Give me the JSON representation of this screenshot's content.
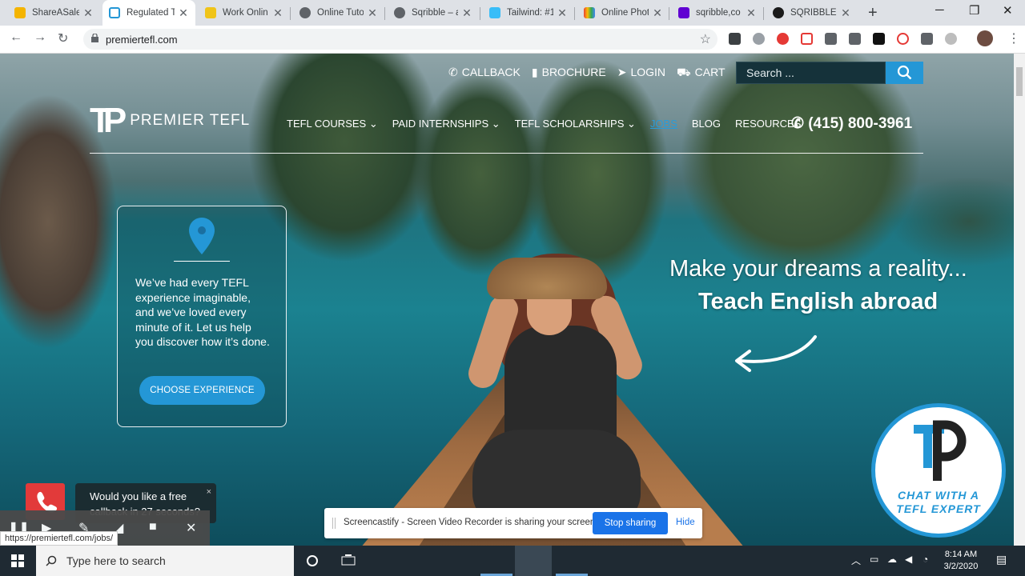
{
  "tabs": [
    {
      "title": "ShareASale",
      "color": "#f4b400"
    },
    {
      "title": "Regulated T",
      "color": "#2497d6"
    },
    {
      "title": "Work Onlin",
      "color": "#f0c419"
    },
    {
      "title": "Online Tuto",
      "color": "#5f6368"
    },
    {
      "title": "Sqribble – a",
      "color": "#5f6368"
    },
    {
      "title": "Tailwind: #1",
      "color": "#38bdf8"
    },
    {
      "title": "Online Phot",
      "color": "#e94235"
    },
    {
      "title": "sqribble,co",
      "color": "#6001d2"
    },
    {
      "title": "SQRIBBLE -",
      "color": "#1a1a1a"
    }
  ],
  "browser": {
    "url": "premiertefl.com",
    "status_url": "https://premiertefl.com/jobs/"
  },
  "site": {
    "toplinks": [
      "CALLBACK",
      "BROCHURE",
      "LOGIN",
      "CART"
    ],
    "search_placeholder": "Search ...",
    "logo_mark": "TP",
    "logo_name": "PREMIER TEFL",
    "nav": [
      "TEFL COURSES",
      "PAID INTERNSHIPS",
      "TEFL SCHOLARSHIPS",
      "JOBS",
      "BLOG",
      "RESOURCES"
    ],
    "phone": "(415) 800-3961",
    "card_text": "We’ve had every TEFL experience imaginable, and we’ve loved every minute of it. Let us help you discover how it’s done.",
    "card_button": "CHOOSE EXPERIENCE",
    "tagline1": "Make your dreams a reality...",
    "tagline2": "Teach English abroad",
    "chat_label_1": "CHAT WITH A",
    "chat_label_2": "TEFL EXPERT",
    "callback_bubble": "Would you like a free callback in 27 seconds?",
    "callback_close": "×"
  },
  "screencastify": {
    "message": "Screencastify - Screen Video Recorder is sharing your screen.",
    "stop": "Stop sharing",
    "hide": "Hide"
  },
  "taskbar": {
    "search": "Type here to search",
    "time": "8:14 AM",
    "date": "3/2/2020"
  },
  "colors": {
    "accent": "#2497d6",
    "jobs_hover": "#2a9bd8"
  }
}
